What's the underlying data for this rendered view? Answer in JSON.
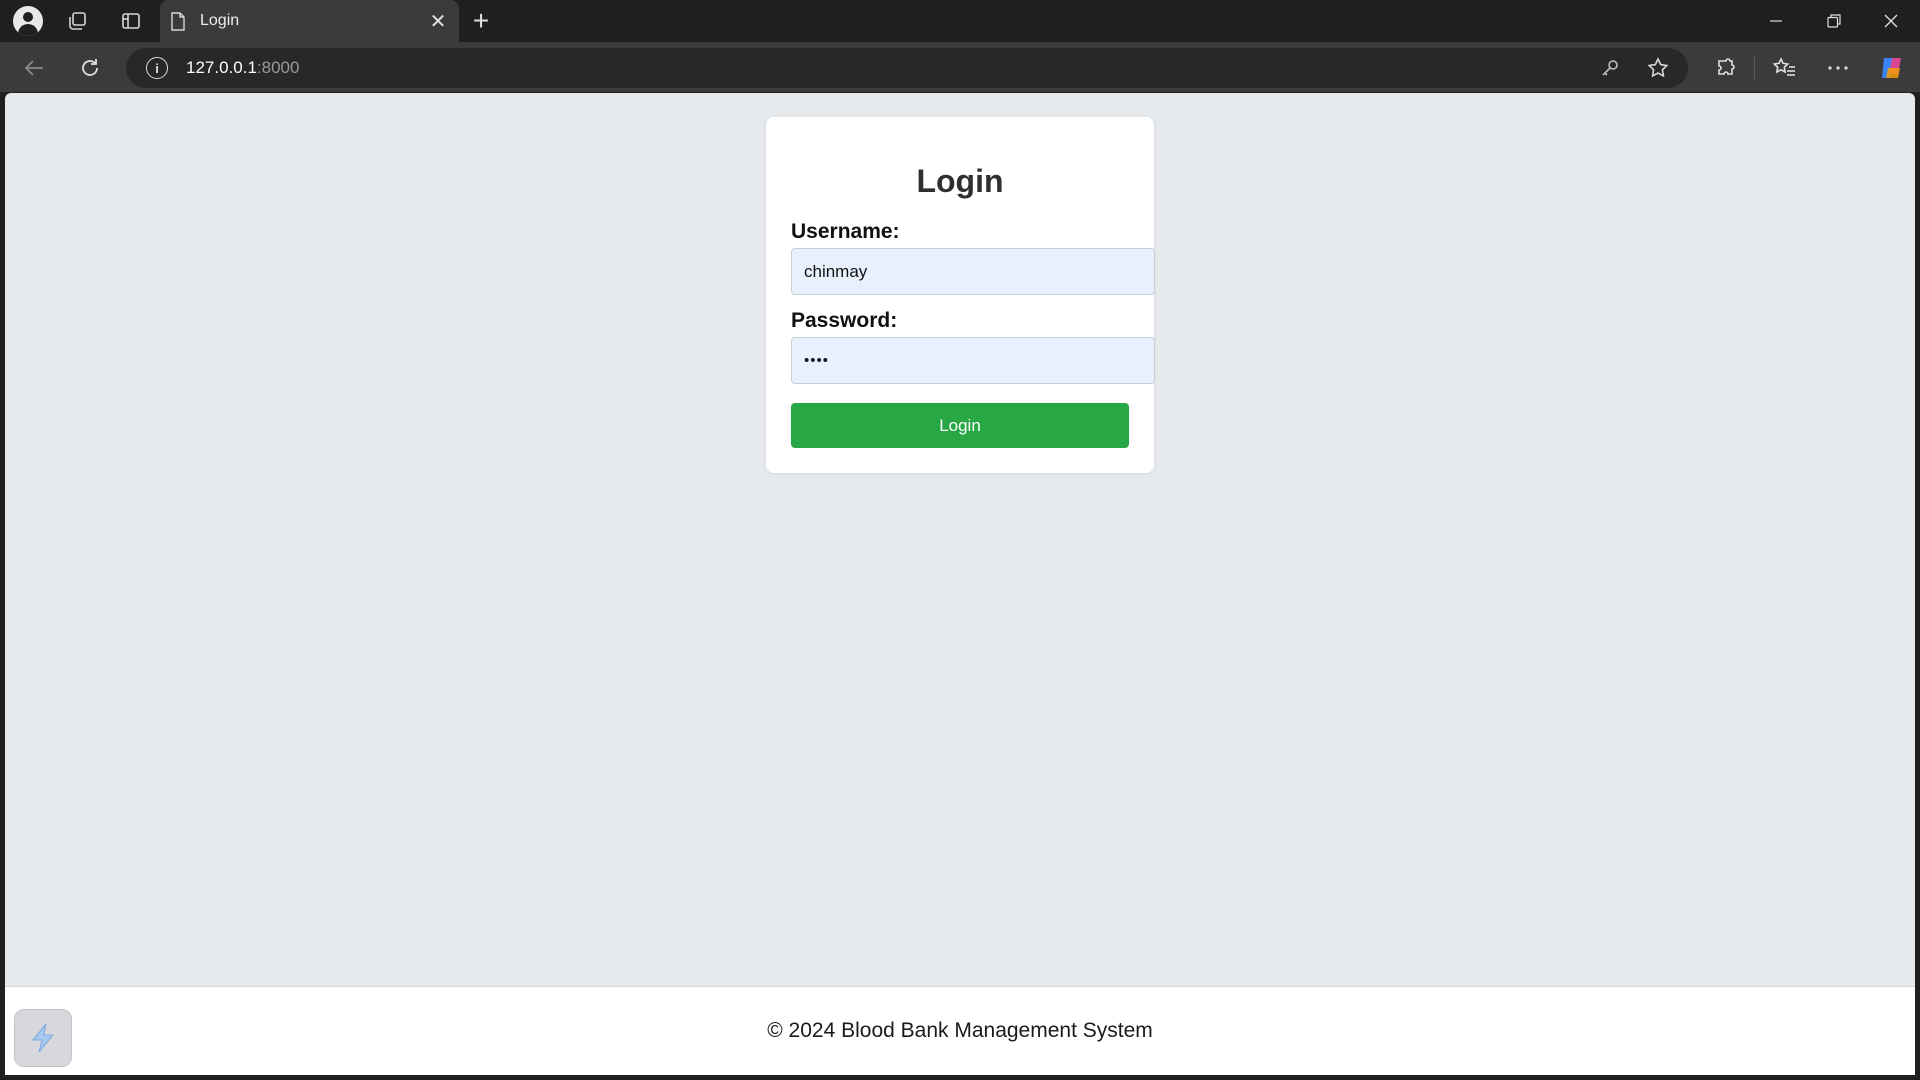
{
  "browser": {
    "tab": {
      "title": "Login",
      "icon": "page-icon"
    },
    "address": {
      "host": "127.0.0.1",
      "port": ":8000"
    }
  },
  "login_form": {
    "title": "Login",
    "username_label": "Username:",
    "username_value": "chinmay",
    "password_label": "Password:",
    "password_value": "••••",
    "submit_label": "Login",
    "submit_color": "#28a745",
    "input_autofill_bg": "#e8f0fe"
  },
  "footer": {
    "text": "© 2024 Blood Bank Management System"
  },
  "colors": {
    "page_bg": "#e7eaed",
    "chrome_bg": "#1f1f1f",
    "toolbar_bg": "#3b3b3b"
  }
}
